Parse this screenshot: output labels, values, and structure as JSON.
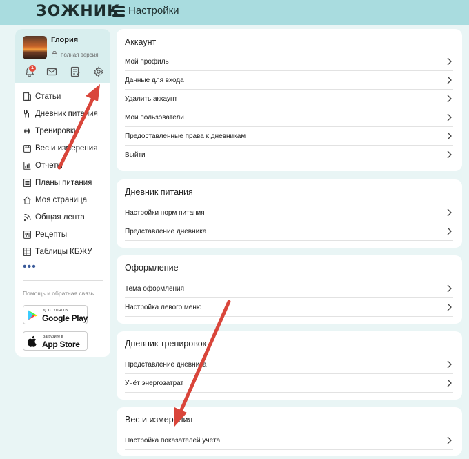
{
  "header": {
    "logo": "ЗОЖНИК",
    "title": "Настройки"
  },
  "profile": {
    "name": "Глория",
    "version": "полная версия",
    "notifications_count": "1",
    "icons": [
      "bell-icon",
      "mail-icon",
      "notes-icon",
      "gear-icon"
    ]
  },
  "nav": {
    "items": [
      {
        "label": "Статьи",
        "icon": "articles-icon"
      },
      {
        "label": "Дневник питания",
        "icon": "food-diary-icon"
      },
      {
        "label": "Тренировки",
        "icon": "workout-icon"
      },
      {
        "label": "Вес и измерения",
        "icon": "scale-icon"
      },
      {
        "label": "Отчеты",
        "icon": "chart-icon"
      },
      {
        "label": "Планы питания",
        "icon": "meal-plan-icon"
      },
      {
        "label": "Моя страница",
        "icon": "home-icon"
      },
      {
        "label": "Общая лента",
        "icon": "feed-icon"
      },
      {
        "label": "Рецепты",
        "icon": "recipe-icon"
      },
      {
        "label": "Таблицы КБЖУ",
        "icon": "table-icon"
      }
    ],
    "more": "•••",
    "help": "Помощь и обратная связь"
  },
  "stores": {
    "google_small": "ДОСТУПНО В",
    "google_big": "Google Play",
    "apple_small": "Загрузите в",
    "apple_big": "App Store"
  },
  "sections": [
    {
      "title": "Аккаунт",
      "items": [
        "Мой профиль",
        "Данные для входа",
        "Удалить аккаунт",
        "Мои пользователи",
        "Предоставленные права к дневникам",
        "Выйти"
      ]
    },
    {
      "title": "Дневник питания",
      "items": [
        "Настройки норм питания",
        "Представление дневника"
      ]
    },
    {
      "title": "Оформление",
      "items": [
        "Тема оформления",
        "Настройка левого меню"
      ]
    },
    {
      "title": "Дневник тренировок",
      "items": [
        "Представление дневника",
        "Учёт энергозатрат"
      ]
    },
    {
      "title": "Вес и измерения",
      "items": [
        "Настройка показателей учёта"
      ]
    }
  ],
  "colors": {
    "header_bg": "#a9dcdf",
    "page_bg": "#e9f5f5",
    "badge": "#e24a3b",
    "annotation_arrow": "#d9453a"
  }
}
